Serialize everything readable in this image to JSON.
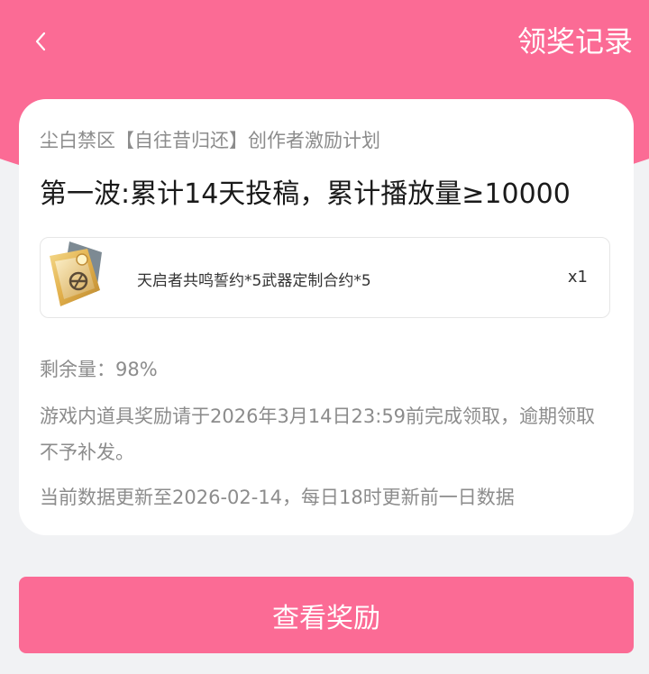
{
  "header": {
    "back_icon": "chevron-left-icon",
    "records_label": "领奖记录"
  },
  "card": {
    "subtitle": "尘白禁区【自往昔归还】创作者激励计划",
    "title": "第一波:累计14天投稿，累计播放量≥10000",
    "reward": {
      "icon": "contract-item-icon",
      "name": "天启者共鸣誓约*5武器定制合约*5",
      "quantity": "x1"
    },
    "remaining": "剩余量：98%",
    "notice": "游戏内道具奖励请于2026年3月14日23:59前完成领取，逾期领取不予补发。",
    "update_note": "当前数据更新至2026-02-14，每日18时更新前一日数据"
  },
  "action": {
    "view_reward_label": "查看奖励"
  },
  "colors": {
    "accent": "#fb6b95",
    "background": "#f1f2f4",
    "card": "#ffffff",
    "muted_text": "#8c8c8c",
    "title_text": "#1a1a1a"
  }
}
